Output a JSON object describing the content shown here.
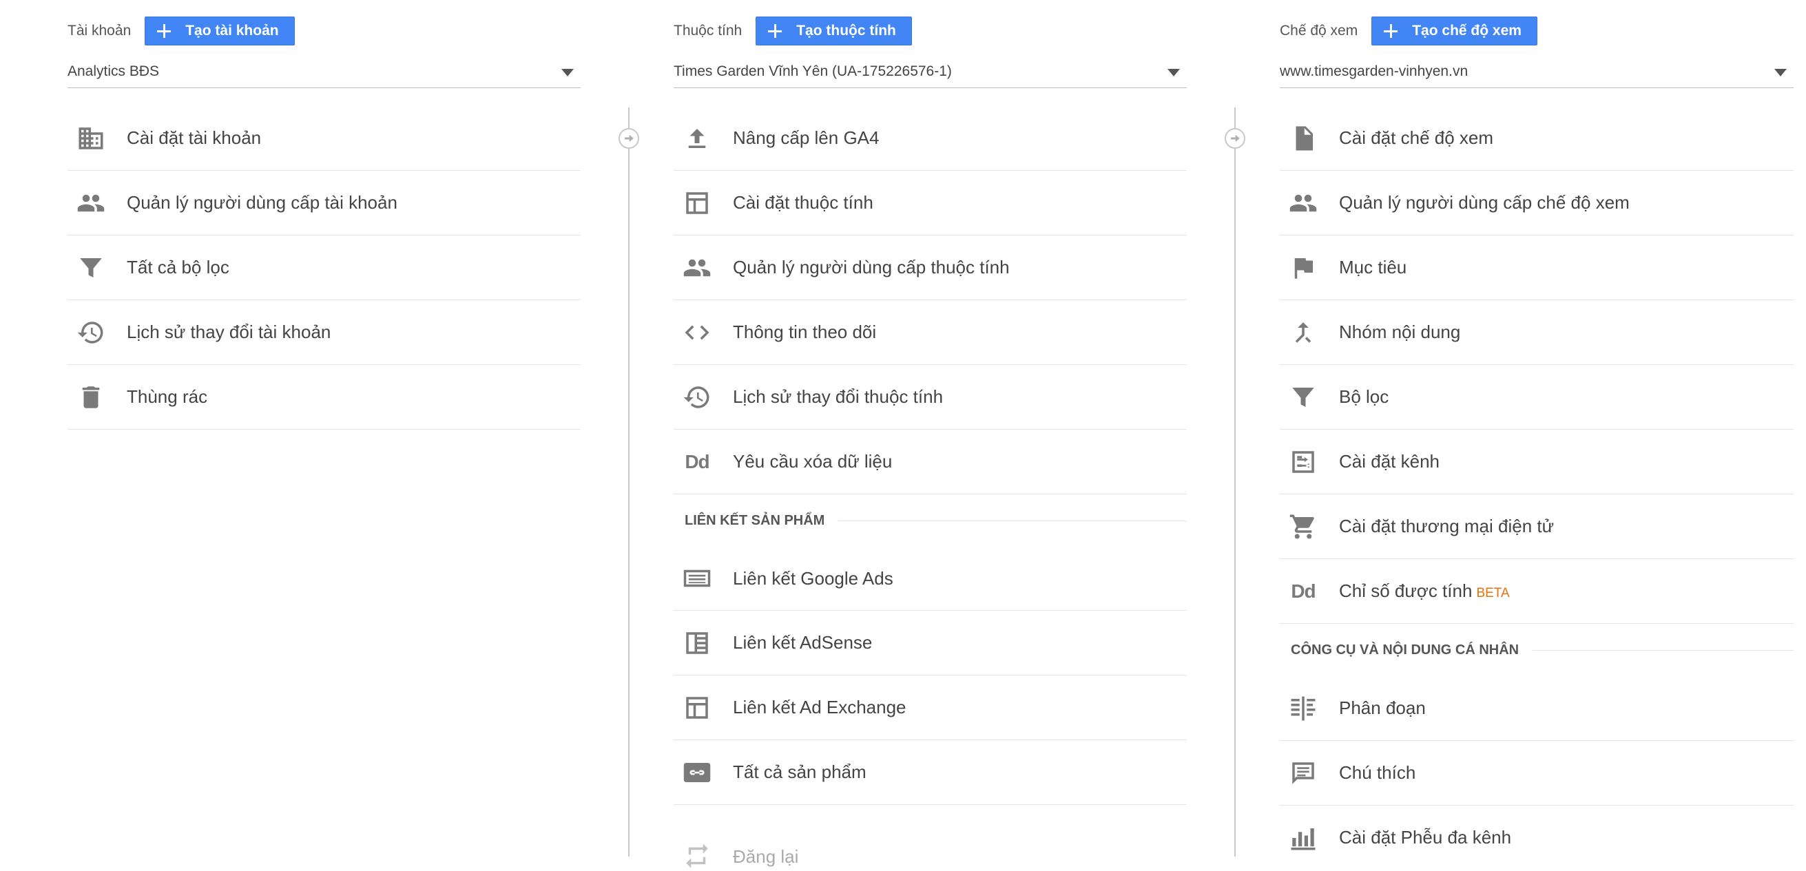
{
  "account": {
    "label": "Tài khoản",
    "create": "Tạo tài khoản",
    "selected": "Analytics BĐS",
    "items": [
      {
        "label": "Cài đặt tài khoản",
        "icon": "building-icon"
      },
      {
        "label": "Quản lý người dùng cấp tài khoản",
        "icon": "people-icon"
      },
      {
        "label": "Tất cả bộ lọc",
        "icon": "filter-icon"
      },
      {
        "label": "Lịch sử thay đổi tài khoản",
        "icon": "history-icon"
      },
      {
        "label": "Thùng rác",
        "icon": "trash-icon"
      }
    ]
  },
  "property": {
    "label": "Thuộc tính",
    "create": "Tạo thuộc tính",
    "selected": "Times Garden Vĩnh Yên (UA-175226576-1)",
    "items": [
      {
        "label": "Nâng cấp lên GA4",
        "icon": "upload-icon"
      },
      {
        "label": "Cài đặt thuộc tính",
        "icon": "layout-icon"
      },
      {
        "label": "Quản lý người dùng cấp thuộc tính",
        "icon": "people-icon"
      },
      {
        "label": "Thông tin theo dõi",
        "icon": "code-icon"
      },
      {
        "label": "Lịch sử thay đổi thuộc tính",
        "icon": "history-icon"
      },
      {
        "label": "Yêu cầu xóa dữ liệu",
        "icon": "dd-icon",
        "glyph": "Dd"
      }
    ],
    "section": "LIÊN KẾT SẢN PHẨM",
    "links": [
      {
        "label": "Liên kết Google Ads",
        "icon": "google-ads-icon"
      },
      {
        "label": "Liên kết AdSense",
        "icon": "adsense-icon"
      },
      {
        "label": "Liên kết Ad Exchange",
        "icon": "ad-exchange-icon"
      },
      {
        "label": "Tất cả sản phẩm",
        "icon": "link-icon"
      },
      {
        "label": "Đăng lại",
        "icon": "repost-icon"
      }
    ]
  },
  "view": {
    "label": "Chế độ xem",
    "create": "Tạo chế độ xem",
    "selected": "www.timesgarden-vinhyen.vn",
    "items": [
      {
        "label": "Cài đặt chế độ xem",
        "icon": "document-icon"
      },
      {
        "label": "Quản lý người dùng cấp chế độ xem",
        "icon": "people-icon"
      },
      {
        "label": "Mục tiêu",
        "icon": "flag-icon"
      },
      {
        "label": "Nhóm nội dung",
        "icon": "merge-icon"
      },
      {
        "label": "Bộ lọc",
        "icon": "filter-icon"
      },
      {
        "label": "Cài đặt kênh",
        "icon": "channel-icon"
      },
      {
        "label": "Cài đặt thương mại điện tử",
        "icon": "cart-icon"
      },
      {
        "label": "Chỉ số được tính",
        "icon": "dd-icon",
        "glyph": "Dd",
        "badge": "BETA"
      }
    ],
    "section": "CÔNG CỤ VÀ NỘI DUNG CÁ NHÂN",
    "tools": [
      {
        "label": "Phân đoạn",
        "icon": "segment-icon"
      },
      {
        "label": "Chú thích",
        "icon": "comment-icon"
      },
      {
        "label": "Cài đặt Phễu đa kênh",
        "icon": "bar-chart-icon"
      }
    ]
  },
  "colors": {
    "accent": "#4285f4",
    "beta": "#e8710a"
  }
}
